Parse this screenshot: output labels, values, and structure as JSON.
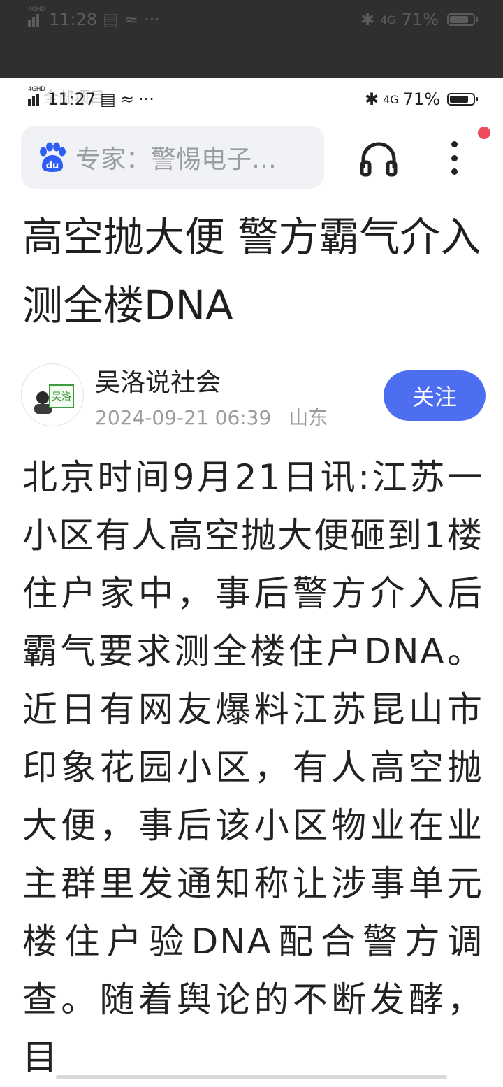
{
  "outer_status": {
    "network": "4GHD",
    "time": "11:28",
    "dots": "···",
    "net_type": "4G",
    "battery": "71%",
    "battery_level": 0.71
  },
  "inner_status": {
    "network": "4GHD",
    "time": "11:27",
    "ghost_text": "全部项目",
    "dots": "···",
    "net_type": "4G",
    "battery": "71%",
    "battery_level": 0.71
  },
  "header": {
    "search_text": "专家：警惕电子…",
    "logo_text": "du",
    "icons": [
      "baidu-paw-icon",
      "headphone-icon",
      "more-vertical-icon"
    ],
    "accent": "#f04a5d"
  },
  "article": {
    "title": "高空抛大便 警方霸气介入测全楼DNA",
    "author": {
      "name": "吴洛说社会",
      "avatar_text": "吴洛",
      "date": "2024-09-21 06:39",
      "location": "山东"
    },
    "follow_label": "关注",
    "follow_color": "#4e6ef2",
    "body": "北京时间9月21日讯:江苏一小区有人高空抛大便砸到1楼住户家中，事后警方介入后霸气要求测全楼住户DNA。近日有网友爆料江苏昆山市印象花园小区，有人高空抛大便，事后该小区物业在业主群里发通知称让涉事单元楼住户验DNA配合警方调查。随着舆论的不断发酵，目"
  }
}
